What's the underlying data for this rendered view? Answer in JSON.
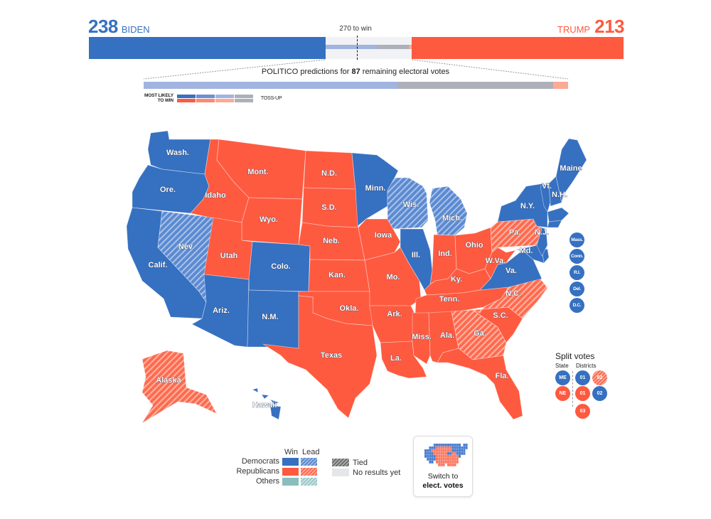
{
  "tally": {
    "dem": {
      "candidate": "BIDEN",
      "electoral_votes": 238,
      "color": "#3670c1"
    },
    "rep": {
      "candidate": "TRUMP",
      "electoral_votes": 213,
      "color": "#fe5a40"
    },
    "threshold_label": "270 to win",
    "threshold": 270,
    "total": 538
  },
  "predictions": {
    "title_prefix": "POLITICO predictions for ",
    "remaining": "87",
    "title_suffix": " remaining electoral votes",
    "segments": [
      {
        "name": "lean-dem",
        "votes": 52,
        "color": "#a1b4e0"
      },
      {
        "name": "toss-up",
        "votes": 32,
        "color": "#aeb0b9"
      },
      {
        "name": "lean-rep",
        "votes": 3,
        "color": "#fdaa94"
      }
    ],
    "legend": {
      "most_likely_label_1": "MOST LIKELY",
      "most_likely_label_2": "TO WIN",
      "toss_up_label": "TOSS-UP",
      "dem_scale": [
        "#3670c1",
        "#6d90d0",
        "#a1b4e0",
        "#aeb0b9"
      ],
      "rep_scale": [
        "#fe5a40",
        "#fd8a70",
        "#fdaa94",
        "#aeb0b9"
      ]
    }
  },
  "colors": {
    "dem_win": "#3670c1",
    "rep_win": "#fe5a40",
    "other_win": "#8bbdbd",
    "tied": "#707070",
    "no_results": "#e5e6ea"
  },
  "states": [
    {
      "abbr": "Wash.",
      "status": "dem-win"
    },
    {
      "abbr": "Ore.",
      "status": "dem-win"
    },
    {
      "abbr": "Calif.",
      "status": "dem-win"
    },
    {
      "abbr": "Nev.",
      "status": "dem-lead"
    },
    {
      "abbr": "Idaho",
      "status": "rep-win"
    },
    {
      "abbr": "Mont.",
      "status": "rep-win"
    },
    {
      "abbr": "Wyo.",
      "status": "rep-win"
    },
    {
      "abbr": "Utah",
      "status": "rep-win"
    },
    {
      "abbr": "Colo.",
      "status": "dem-win"
    },
    {
      "abbr": "Ariz.",
      "status": "dem-win"
    },
    {
      "abbr": "N.M.",
      "status": "dem-win"
    },
    {
      "abbr": "N.D.",
      "status": "rep-win"
    },
    {
      "abbr": "S.D.",
      "status": "rep-win"
    },
    {
      "abbr": "Neb.",
      "status": "rep-win"
    },
    {
      "abbr": "Kan.",
      "status": "rep-win"
    },
    {
      "abbr": "Okla.",
      "status": "rep-win"
    },
    {
      "abbr": "Texas",
      "status": "rep-win"
    },
    {
      "abbr": "Minn.",
      "status": "dem-win"
    },
    {
      "abbr": "Iowa",
      "status": "rep-win"
    },
    {
      "abbr": "Mo.",
      "status": "rep-win"
    },
    {
      "abbr": "Ark.",
      "status": "rep-win"
    },
    {
      "abbr": "La.",
      "status": "rep-win"
    },
    {
      "abbr": "Wis.",
      "status": "dem-lead"
    },
    {
      "abbr": "Ill.",
      "status": "dem-win"
    },
    {
      "abbr": "Mich.",
      "status": "dem-lead"
    },
    {
      "abbr": "Ind.",
      "status": "rep-win"
    },
    {
      "abbr": "Ohio",
      "status": "rep-win"
    },
    {
      "abbr": "Ky.",
      "status": "rep-win"
    },
    {
      "abbr": "Tenn.",
      "status": "rep-win"
    },
    {
      "abbr": "Miss.",
      "status": "rep-win"
    },
    {
      "abbr": "Ala.",
      "status": "rep-win"
    },
    {
      "abbr": "Ga.",
      "status": "rep-lead"
    },
    {
      "abbr": "Fla.",
      "status": "rep-win"
    },
    {
      "abbr": "S.C.",
      "status": "rep-win"
    },
    {
      "abbr": "N.C.",
      "status": "rep-lead"
    },
    {
      "abbr": "Va.",
      "status": "dem-win"
    },
    {
      "abbr": "W.Va.",
      "status": "rep-win"
    },
    {
      "abbr": "Pa.",
      "status": "rep-lead"
    },
    {
      "abbr": "Md.",
      "status": "dem-win"
    },
    {
      "abbr": "N.J.",
      "status": "dem-win"
    },
    {
      "abbr": "N.Y.",
      "status": "dem-win"
    },
    {
      "abbr": "Vt.",
      "status": "dem-win"
    },
    {
      "abbr": "N.H.",
      "status": "dem-win"
    },
    {
      "abbr": "Maine",
      "status": "dem-win"
    },
    {
      "abbr": "Alaska",
      "status": "rep-lead"
    },
    {
      "abbr": "Hawaii",
      "status": "dem-win"
    }
  ],
  "small_states": [
    {
      "abbr": "Mass.",
      "status": "dem-win"
    },
    {
      "abbr": "Conn.",
      "status": "dem-win"
    },
    {
      "abbr": "R.I.",
      "status": "dem-win"
    },
    {
      "abbr": "Del.",
      "status": "dem-win"
    },
    {
      "abbr": "D.C.",
      "status": "dem-win"
    }
  ],
  "split_votes": {
    "title": "Split votes",
    "state_label": "State",
    "districts_label": "Districts",
    "maine": {
      "state": {
        "label": "ME",
        "status": "dem-win"
      },
      "districts": [
        {
          "label": "01",
          "status": "dem-win"
        },
        {
          "label": "02",
          "status": "rep-lead"
        }
      ]
    },
    "nebraska": {
      "state": {
        "label": "NE",
        "status": "rep-win"
      },
      "districts": [
        {
          "label": "01",
          "status": "rep-win"
        },
        {
          "label": "02",
          "status": "dem-win"
        },
        {
          "label": "03",
          "status": "rep-win"
        }
      ]
    }
  },
  "legend": {
    "win_label": "Win",
    "lead_label": "Lead",
    "rows": [
      {
        "label": "Democrats"
      },
      {
        "label": "Republicans"
      },
      {
        "label": "Others"
      }
    ],
    "tied_label": "Tied",
    "no_results_label": "No results yet"
  },
  "switch_button": {
    "line1": "Switch to",
    "line2": "elect. votes"
  }
}
